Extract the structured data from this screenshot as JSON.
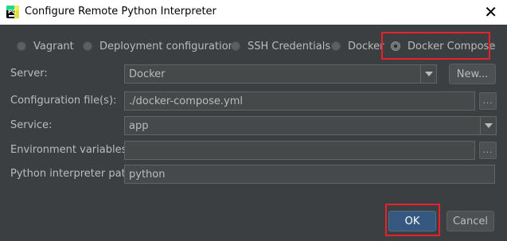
{
  "window": {
    "title": "Configure Remote Python Interpreter",
    "close_glyph": "✕",
    "app_icon": "pycharm-icon",
    "app_icon_text": "PC"
  },
  "radios": {
    "options": [
      "Vagrant",
      "Deployment configuration",
      "SSH Credentials",
      "Docker",
      "Docker Compose"
    ],
    "selected": "Docker Compose"
  },
  "form": {
    "server": {
      "label": "Server:",
      "value": "Docker",
      "new_button": "New..."
    },
    "config_file": {
      "label": "Configuration file(s):",
      "value": "./docker-compose.yml",
      "browse": "..."
    },
    "service": {
      "label": "Service:",
      "value": "app"
    },
    "env": {
      "label": "Environment variables:",
      "value": "",
      "browse": "..."
    },
    "python_path": {
      "label": "Python interpreter path:",
      "value": "python"
    }
  },
  "buttons": {
    "ok": "OK",
    "cancel": "Cancel"
  },
  "colors": {
    "highlight": "#e8212b",
    "background": "#3c3f41",
    "default_button": "#365880"
  }
}
